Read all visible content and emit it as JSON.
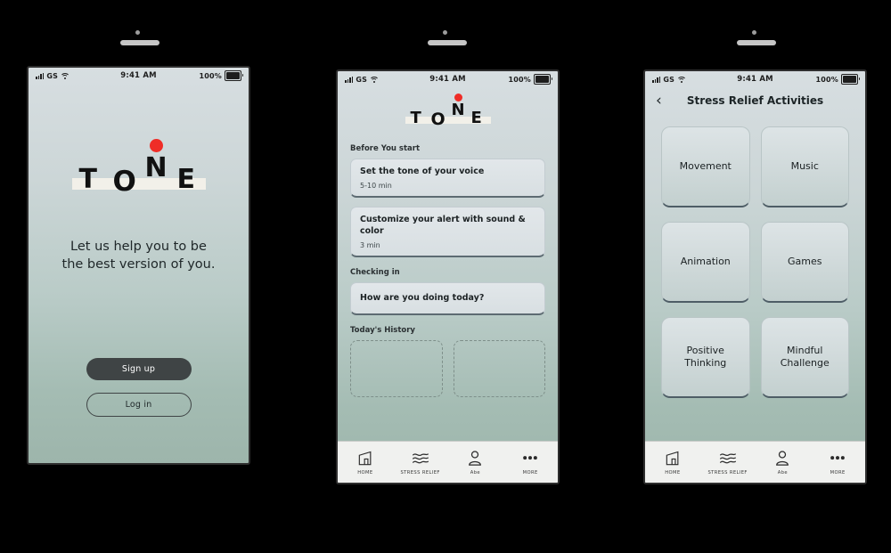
{
  "meta": {
    "background": "#000000",
    "accent_red": "#ef2d27",
    "dark_button": "#3f4445"
  },
  "status_bar": {
    "carrier": "GS",
    "time": "9:41 AM",
    "battery_text": "100%",
    "signal_icon": "signal-bars-icon",
    "wifi_icon": "wifi-icon",
    "battery_icon": "battery-icon"
  },
  "brand": {
    "letters": [
      "T",
      "O",
      "N",
      "E"
    ],
    "dot_icon": "red-dot-icon"
  },
  "screen1": {
    "tagline_line1": "Let us help you to be",
    "tagline_line2": "the best version of you.",
    "signup_label": "Sign up",
    "login_label": "Log in"
  },
  "screen2": {
    "sections": [
      {
        "title": "Before You start",
        "cards": [
          {
            "title": "Set the tone of your voice",
            "sub": "5-10 min"
          },
          {
            "title": "Customize your alert with sound & color",
            "sub": "3 min"
          }
        ]
      },
      {
        "title": "Checking in",
        "cards": [
          {
            "title": "How are you doing today?",
            "sub": ""
          }
        ]
      },
      {
        "title": "Today's History",
        "cards": []
      }
    ]
  },
  "screen3": {
    "nav_title": "Stress Relief Activities",
    "back_icon": "chevron-left-icon",
    "tiles": [
      {
        "label": "Movement"
      },
      {
        "label": "Music"
      },
      {
        "label": "Animation"
      },
      {
        "label": "Games"
      },
      {
        "label": "Positive Thinking"
      },
      {
        "label": "Mindful Challenge"
      }
    ]
  },
  "tab_bar": {
    "items": [
      {
        "label": "HOME",
        "icon": "home-icon"
      },
      {
        "label": "STRESS RELIEF",
        "icon": "waves-icon"
      },
      {
        "label": "Abe",
        "icon": "person-icon"
      },
      {
        "label": "MORE",
        "icon": "ellipsis-icon"
      }
    ]
  }
}
